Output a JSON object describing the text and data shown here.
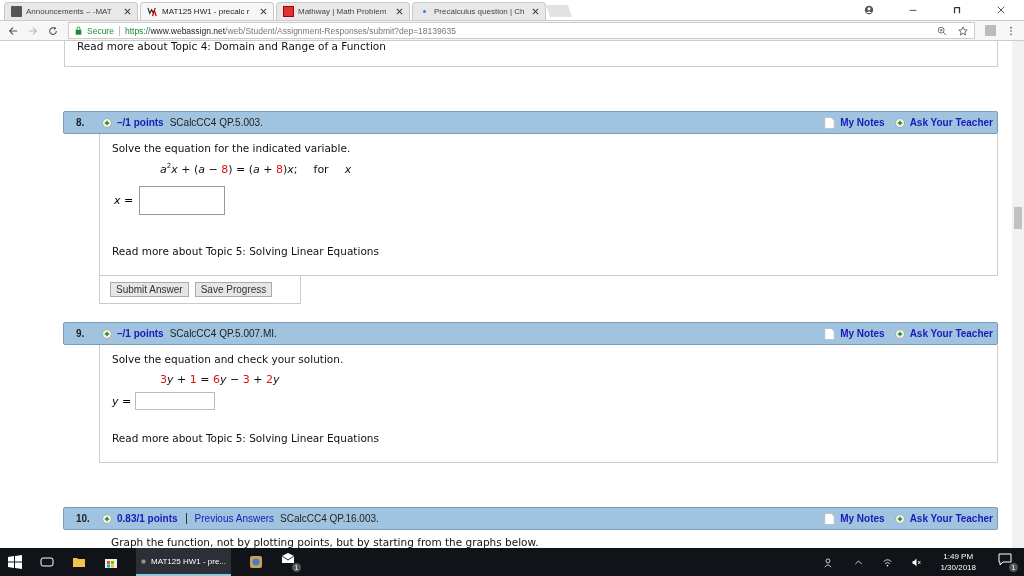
{
  "browser": {
    "tabs": [
      {
        "title": "Announcements – -MAT",
        "selected": false
      },
      {
        "title": "MAT125 HW1 - precalc r",
        "selected": true
      },
      {
        "title": "Mathway | Math Problem",
        "selected": false
      },
      {
        "title": "Precalculus question | Ch",
        "selected": false
      }
    ],
    "secure_label": "Secure",
    "url_scheme": "https://",
    "url_host": "www.webassign.net",
    "url_path": "/web/Student/Assignment-Responses/submit?dep=18139635"
  },
  "previous_link": "Read more about Topic 4: Domain and Range of a Function",
  "questions": [
    {
      "kind": "boxed",
      "number": "8.",
      "points": "–/1 points",
      "code": "SCalcCC4 QP.5.003.",
      "notes": "My Notes",
      "ask": "Ask Your Teacher",
      "prompt": "Solve the equation for the indicated variable.",
      "equation": [
        {
          "kind": "var",
          "text": "a"
        },
        {
          "kind": "sup",
          "text": "2"
        },
        {
          "kind": "var",
          "text": "x"
        },
        {
          "kind": "op",
          "text": " + ("
        },
        {
          "kind": "var",
          "text": "a"
        },
        {
          "kind": "op",
          "text": " − "
        },
        {
          "kind": "num",
          "text": "8"
        },
        {
          "kind": "op",
          "text": ") = ("
        },
        {
          "kind": "var",
          "text": "a"
        },
        {
          "kind": "op",
          "text": " + "
        },
        {
          "kind": "num",
          "text": "8"
        },
        {
          "kind": "op",
          "text": ")"
        },
        {
          "kind": "var",
          "text": "x"
        },
        {
          "kind": "op",
          "text": ";"
        }
      ],
      "for_label": "for",
      "for_var": "x",
      "answer_label": "*x* =",
      "read_more": "Read more about Topic 5: Solving Linear Equations",
      "buttons": [
        "Submit Answer",
        "Save Progress"
      ]
    },
    {
      "kind": "inline",
      "number": "9.",
      "points": "–/1 points",
      "code": "SCalcCC4 QP.5.007.MI.",
      "notes": "My Notes",
      "ask": "Ask Your Teacher",
      "prompt": "Solve the equation and check your solution.",
      "equation": [
        {
          "kind": "num",
          "text": "3"
        },
        {
          "kind": "var",
          "text": "y"
        },
        {
          "kind": "op",
          "text": " + "
        },
        {
          "kind": "num",
          "text": "1"
        },
        {
          "kind": "op",
          "text": " = "
        },
        {
          "kind": "num",
          "text": "6"
        },
        {
          "kind": "var",
          "text": "y"
        },
        {
          "kind": "op",
          "text": " − "
        },
        {
          "kind": "num",
          "text": "3"
        },
        {
          "kind": "op",
          "text": " + "
        },
        {
          "kind": "num",
          "text": "2"
        },
        {
          "kind": "var",
          "text": "y"
        }
      ],
      "answer_label": "*y* =",
      "read_more": "Read more about Topic 5: Solving Linear Equations"
    },
    {
      "kind": "graph",
      "number": "10.",
      "points": "0.83/1 points",
      "previous_answers": "Previous Answers",
      "code": "SCalcCC4 QP.16.003.",
      "notes": "My Notes",
      "ask": "Ask Your Teacher",
      "prompt": "Graph the function, not by plotting points, but by starting from the graphs below."
    }
  ],
  "taskbar": {
    "active_app": "MAT125 HW1 - pre...",
    "time": "1:49 PM",
    "date": "1/30/2018",
    "mail_badge": "1",
    "notification_badge": "1"
  }
}
